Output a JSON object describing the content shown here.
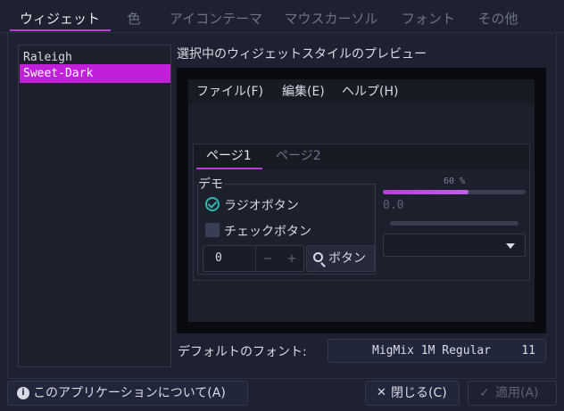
{
  "tabs": [
    {
      "label": "ウィジェット",
      "active": true
    },
    {
      "label": "色",
      "active": false
    },
    {
      "label": "アイコンテーマ",
      "active": false
    },
    {
      "label": "マウスカーソル",
      "active": false
    },
    {
      "label": "フォント",
      "active": false
    },
    {
      "label": "その他",
      "active": false
    }
  ],
  "themes": {
    "items": [
      "Raleigh",
      "Sweet-Dark"
    ],
    "selected": "Sweet-Dark"
  },
  "preview": {
    "title": "選択中のウィジェットスタイルのプレビュー",
    "menu": [
      "ファイル(F)",
      "編集(E)",
      "ヘルプ(H)"
    ],
    "pages": [
      "ページ1",
      "ページ2"
    ],
    "frame_label": "デモ",
    "radio_label": "ラジオボタン",
    "check_label": "チェックボタン",
    "spin_value": "0",
    "spin_minus": "−",
    "spin_plus": "+",
    "button_label": "ボタン",
    "progress_text": "60 %",
    "progress_fraction": 0.6,
    "scale_value": "0.0"
  },
  "font": {
    "label": "デフォルトのフォント:",
    "name": "MigMix 1M Regular",
    "size": "11"
  },
  "buttons": {
    "about": "このアプリケーションについて(A)",
    "close": "閉じる(C)",
    "apply": "適用(A)"
  },
  "colors": {
    "accent": "#c020d8",
    "radio": "#2fb8b0",
    "background": "#1e2130"
  }
}
